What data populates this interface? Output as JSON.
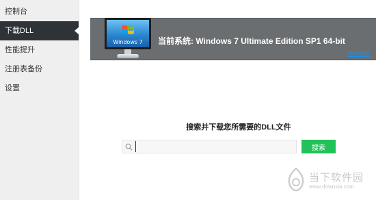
{
  "sidebar": {
    "items": [
      {
        "label": "控制台",
        "active": false
      },
      {
        "label": "下载DLL",
        "active": true
      },
      {
        "label": "性能提升",
        "active": false
      },
      {
        "label": "注册表备份",
        "active": false
      },
      {
        "label": "设置",
        "active": false
      }
    ]
  },
  "banner": {
    "monitor_label": "Windows 7",
    "system_text": "当前系统: Windows 7 Ultimate Edition SP1 64-bit",
    "manual_link": "手动选择"
  },
  "search": {
    "title": "搜索并下载您所需要的DLL文件",
    "placeholder": "",
    "value": "",
    "button_label": "搜索"
  },
  "watermark": {
    "title": "当下软件园",
    "url": "www.downxia.com"
  },
  "colors": {
    "sidebar_active_bg": "#2e3338",
    "banner_bg": "#6b6e70",
    "search_button": "#22c25a",
    "link": "#1b8fe8"
  }
}
